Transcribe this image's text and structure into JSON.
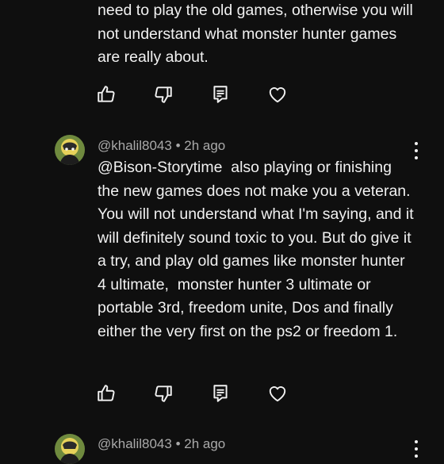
{
  "comments": [
    {
      "text": "need to play the old games, otherwise you will not understand what monster hunter games are really about."
    },
    {
      "author": "@khalil8043",
      "time": "2h ago",
      "separator": "•",
      "text": "@Bison-Storytime  also playing or finishing the new games does not make you a veteran.  You will not understand what I'm saying, and it will definitely sound toxic to you. But do give it a try, and play old games like monster hunter 4 ultimate,  monster hunter 3 ultimate or portable 3rd, freedom unite, Dos and finally either the very first on the ps2 or freedom 1."
    },
    {
      "author": "@khalil8043",
      "time": "2h ago",
      "separator": "•"
    }
  ],
  "icons": {
    "like": "thumbs-up-icon",
    "dislike": "thumbs-down-icon",
    "reply": "reply-comment-icon",
    "heart": "heart-icon",
    "more": "more-vertical-icon"
  },
  "colors": {
    "background": "#0f0f0f",
    "text": "#f1f1f1",
    "meta": "#aaaaaa"
  }
}
